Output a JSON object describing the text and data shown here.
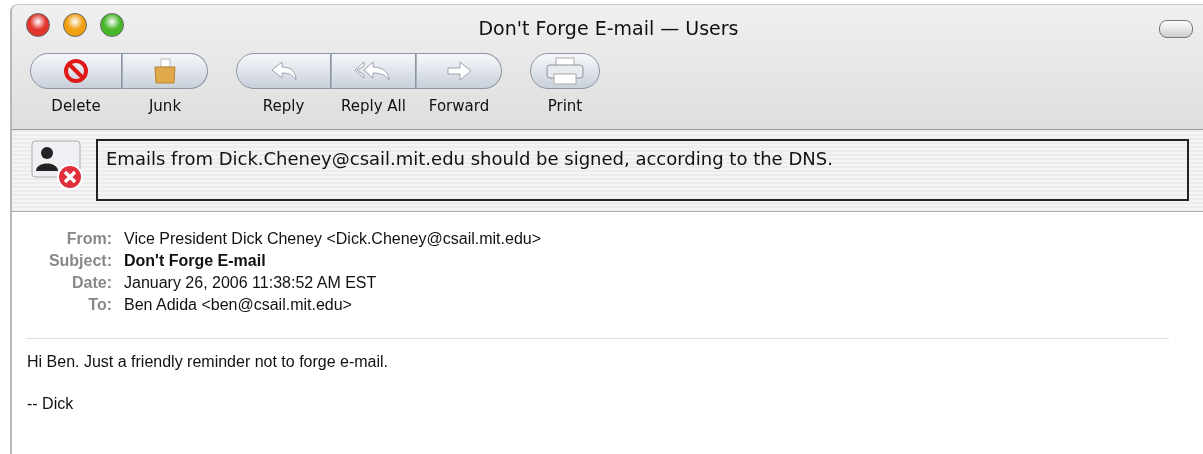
{
  "window": {
    "title": "Don't Forge E-mail — Users"
  },
  "toolbar": {
    "groups": [
      {
        "buttons": [
          {
            "label": "Delete",
            "kind": "delete"
          },
          {
            "label": "Junk",
            "kind": "junk"
          }
        ]
      },
      {
        "buttons": [
          {
            "label": "Reply",
            "kind": "reply"
          },
          {
            "label": "Reply All",
            "kind": "reply-all"
          },
          {
            "label": "Forward",
            "kind": "forward"
          }
        ]
      },
      {
        "buttons": [
          {
            "label": "Print",
            "kind": "print"
          }
        ]
      }
    ]
  },
  "banner": {
    "message": "Emails from Dick.Cheney@csail.mit.edu should be signed, according to the DNS."
  },
  "headers": [
    {
      "label": "From:",
      "value": "Vice President Dick Cheney <Dick.Cheney@csail.mit.edu>",
      "bold": false
    },
    {
      "label": "Subject:",
      "value": "Don't Forge E-mail",
      "bold": true
    },
    {
      "label": "Date:",
      "value": "January 26, 2006 11:38:52 AM EST",
      "bold": false
    },
    {
      "label": "To:",
      "value": "Ben Adida <ben@csail.mit.edu>",
      "bold": false
    }
  ],
  "body": [
    "Hi Ben. Just a friendly reminder not to forge e-mail.",
    "-- Dick"
  ]
}
